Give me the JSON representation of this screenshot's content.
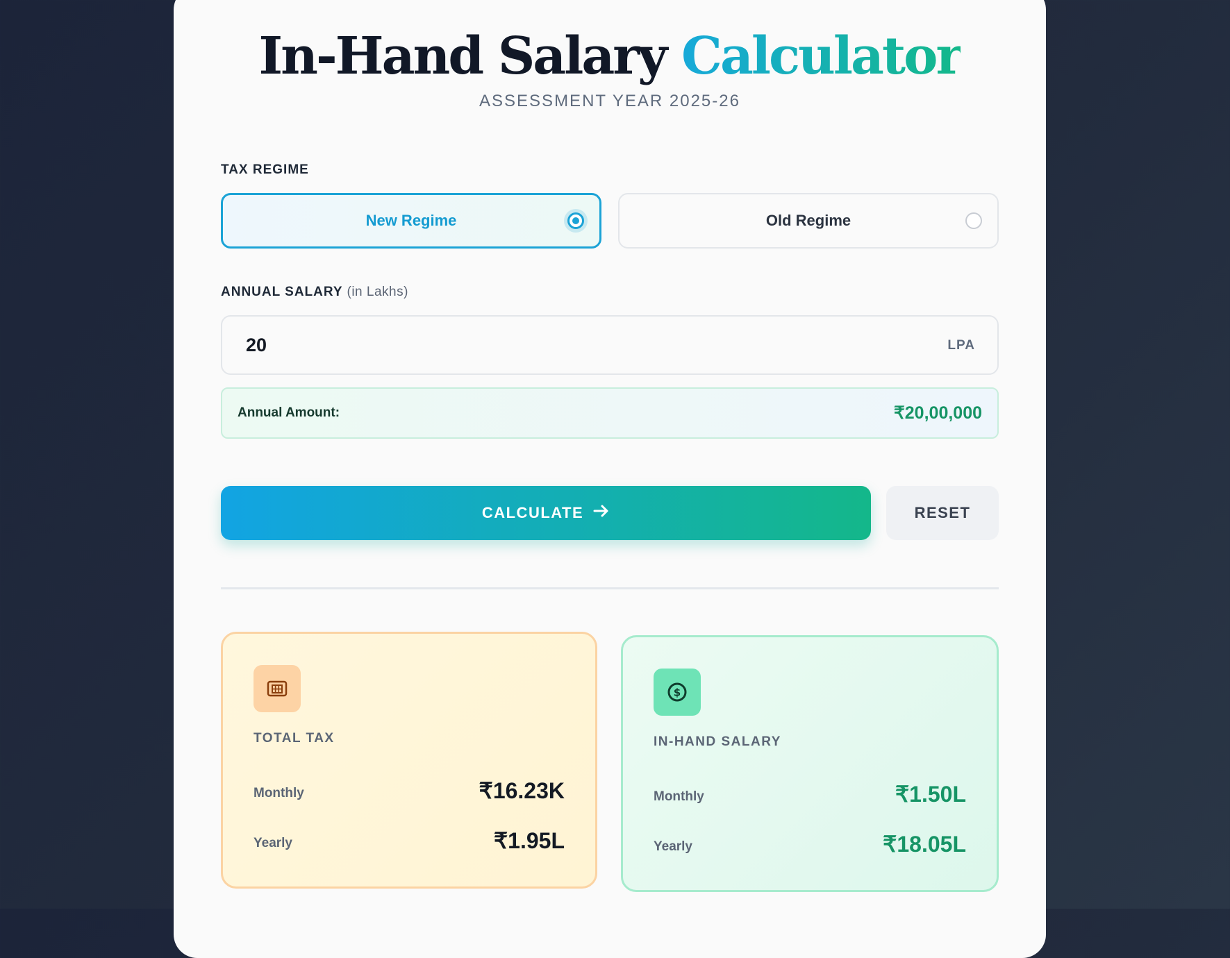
{
  "header": {
    "title_main": "In-Hand Salary",
    "title_accent": "Calculator",
    "subtitle": "ASSESSMENT YEAR 2025-26"
  },
  "tax_regime": {
    "label": "TAX REGIME",
    "options": [
      {
        "label": "New Regime",
        "selected": true
      },
      {
        "label": "Old Regime",
        "selected": false
      }
    ]
  },
  "salary": {
    "label": "ANNUAL SALARY",
    "label_hint": "(in Lakhs)",
    "value": "20",
    "unit": "LPA",
    "annual_amount_label": "Annual Amount:",
    "annual_amount_value": "₹20,00,000"
  },
  "actions": {
    "calculate_label": "CALCULATE",
    "calculate_icon": "arrow-right-icon",
    "reset_label": "RESET"
  },
  "results": {
    "total_tax": {
      "icon": "calculator-icon",
      "title": "TOTAL TAX",
      "monthly_label": "Monthly",
      "monthly_value": "₹16.23K",
      "yearly_label": "Yearly",
      "yearly_value": "₹1.95L"
    },
    "in_hand": {
      "icon": "dollar-circle-icon",
      "title": "IN-HAND SALARY",
      "monthly_label": "Monthly",
      "monthly_value": "₹1.50L",
      "yearly_label": "Yearly",
      "yearly_value": "₹18.05L"
    }
  },
  "colors": {
    "accent_blue": "#1ba3d6",
    "accent_green": "#14b78a",
    "tax_card_bg": "#fff6d8",
    "inhand_card_bg": "#e4f9ef"
  }
}
